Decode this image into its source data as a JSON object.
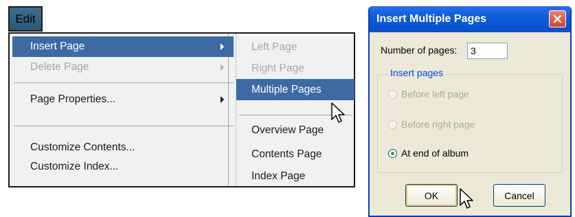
{
  "menubar": {
    "edit_label": "Edit"
  },
  "menu": {
    "items": [
      {
        "label": "Insert Page",
        "state": "active",
        "has_submenu": true
      },
      {
        "label": "Delete Page",
        "state": "disabled",
        "has_submenu": true
      },
      {
        "label": "Page Properties...",
        "state": "normal",
        "has_submenu": true
      },
      {
        "label": "Customize Contents...",
        "state": "normal",
        "has_submenu": false
      },
      {
        "label": "Customize Index...",
        "state": "normal",
        "has_submenu": false
      }
    ],
    "submenu": [
      {
        "label": "Left Page",
        "state": "disabled"
      },
      {
        "label": "Right Page",
        "state": "disabled"
      },
      {
        "label": "Multiple Pages",
        "state": "active"
      },
      {
        "label": "Overview Page",
        "state": "normal"
      },
      {
        "label": "Contents Page",
        "state": "normal"
      },
      {
        "label": "Index Page",
        "state": "normal"
      }
    ]
  },
  "dialog": {
    "title": "Insert Multiple Pages",
    "num_pages_label": "Number of pages:",
    "num_pages_value": "3",
    "group_title": "Insert pages",
    "options": [
      {
        "label": "Before left page",
        "selected": false,
        "enabled": false
      },
      {
        "label": "Before right page",
        "selected": false,
        "enabled": false
      },
      {
        "label": "At end of album",
        "selected": true,
        "enabled": true
      }
    ],
    "ok_label": "OK",
    "cancel_label": "Cancel"
  },
  "colors": {
    "menu_highlight": "#3d6aa2",
    "titlebar": "#0a50cc",
    "dialog_bg": "#ece9d8",
    "group_title": "#0046d5",
    "radio_dot": "#21a121"
  },
  "icons": [
    "menu-arrow-icon",
    "mouse-pointer-icon",
    "close-icon"
  ]
}
